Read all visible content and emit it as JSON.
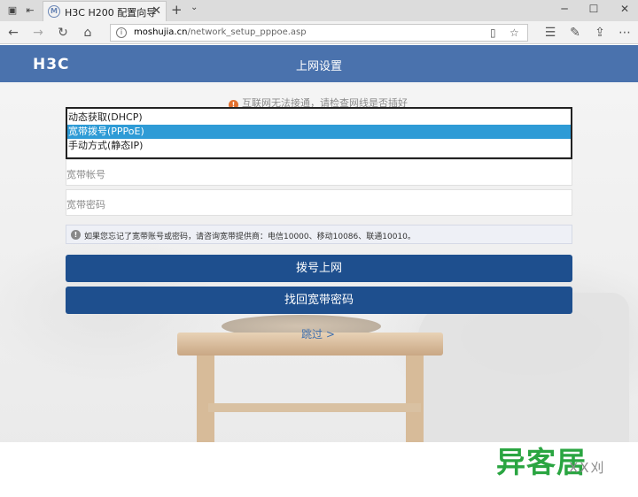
{
  "browser": {
    "tab_title": "H3C H200 配置向导",
    "favicon_letter": "M",
    "url_host": "moshujia.cn",
    "url_path": "/network_setup_pppoe.asp"
  },
  "header": {
    "logo": "H3C",
    "title": "上网设置"
  },
  "warning": {
    "text": "互联网无法接通，请检查网线是否插好",
    "color": "#e2702f"
  },
  "connection_modes": {
    "options": [
      "动态获取(DHCP)",
      "宽带拨号(PPPoE)",
      "手动方式(静态IP)"
    ],
    "selected_index": 1,
    "selected_color": "#2e9bd6"
  },
  "form": {
    "account_label": "宽带帐号",
    "password_label": "宽带密码"
  },
  "hint": {
    "text": "如果您忘记了宽带账号或密码，请咨询宽带提供商：电信10000、移动10086、联通10010。"
  },
  "buttons": {
    "dial": "拨号上网",
    "recover": "找回宽带密码",
    "color": "#1e4f8e"
  },
  "skip": {
    "label": "跳过 >"
  },
  "watermark": {
    "main": "异客居",
    "sub": "XX刈"
  }
}
